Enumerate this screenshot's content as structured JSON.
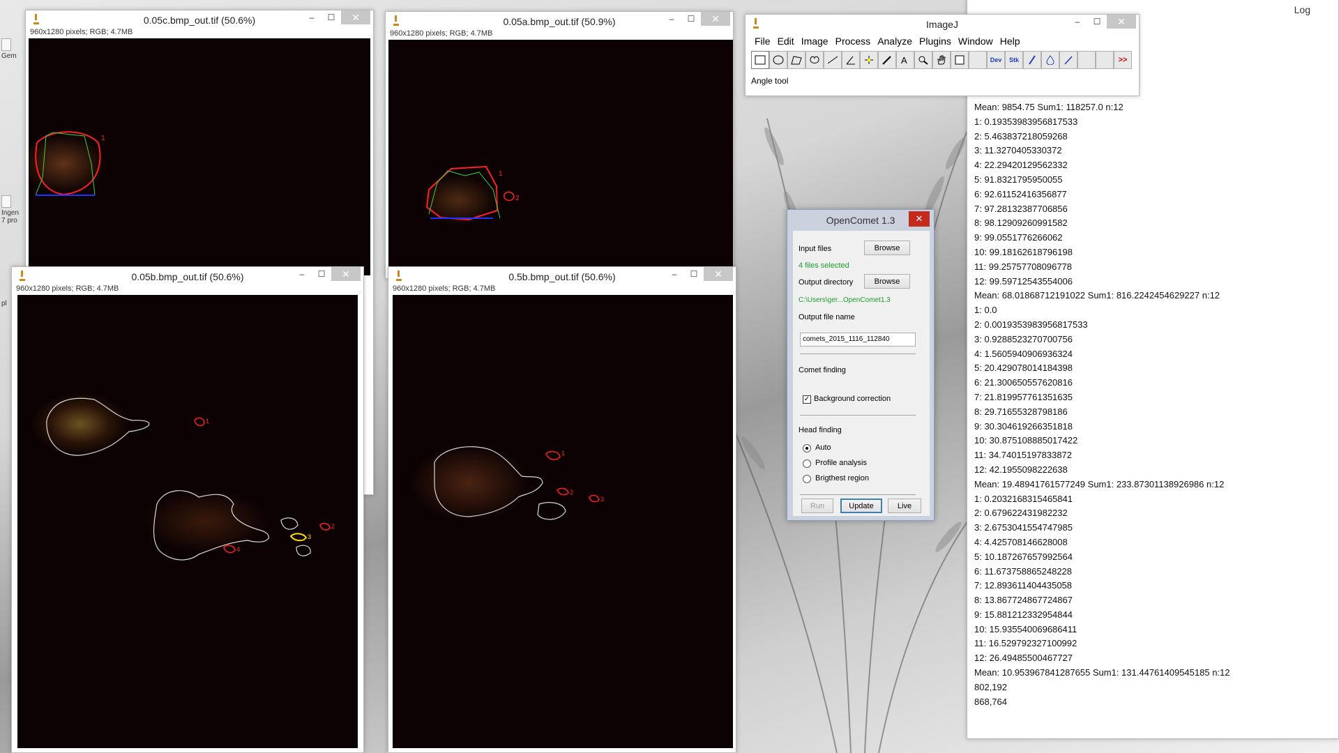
{
  "desktop": {
    "icon_labels": [
      "Gem",
      "Ingen\n7 pro",
      "pl"
    ]
  },
  "image_windows": [
    {
      "title": "0.05c.bmp_out.tif (50.6%)",
      "info": "960x1280 pixels; RGB; 4.7MB",
      "roi_labels": [
        "1"
      ]
    },
    {
      "title": "0.05a.bmp_out.tif (50.9%)",
      "info": "960x1280 pixels; RGB; 4.7MB",
      "roi_labels": [
        "1",
        "2"
      ]
    },
    {
      "title": "0.05b.bmp_out.tif (50.6%)",
      "info": "960x1280 pixels; RGB; 4.7MB",
      "roi_labels": [
        "1",
        "2",
        "3",
        "4"
      ]
    },
    {
      "title": "0.5b.bmp_out.tif (50.6%)",
      "info": "960x1280 pixels; RGB; 4.7MB",
      "roi_labels": [
        "1",
        "2",
        "3"
      ]
    }
  ],
  "imagej": {
    "title": "ImageJ",
    "menu": [
      "File",
      "Edit",
      "Image",
      "Process",
      "Analyze",
      "Plugins",
      "Window",
      "Help"
    ],
    "tools": [
      "rectangle-icon",
      "oval-icon",
      "polygon-icon",
      "freehand-icon",
      "line-icon",
      "angle-icon",
      "point-icon",
      "wand-icon",
      "text-icon",
      "magnifier-icon",
      "hand-icon",
      "color-picker-icon",
      "blank",
      "Dev",
      "Stk",
      "brush-icon",
      "flood-icon",
      "pencil-icon",
      "blank",
      "blank",
      ">>"
    ],
    "status": "Angle tool"
  },
  "log": {
    "title": "Log",
    "lines": [
      "Mean: 9854.75 Sum1: 118257.0 n:12",
      "1: 0.19353983956817533",
      "2: 5.463837218059268",
      "3: 11.3270405330372",
      "4: 22.29420129562332",
      "5: 91.8321795950055",
      "6: 92.61152416356877",
      "7: 97.28132387706856",
      "8: 98.12909260991582",
      "9: 99.0551776266062",
      "10: 99.18162618796198",
      "11: 99.25757708096778",
      "12: 99.59712543554006",
      "Mean: 68.01868712191022 Sum1: 816.2242454629227 n:12",
      "1: 0.0",
      "2: 0.0019353983956817533",
      "3: 0.9288523270700756",
      "4: 1.5605940906936324",
      "5: 20.429078014184398",
      "6: 21.300650557620816",
      "7: 21.819957761351635",
      "8: 29.71655328798186",
      "9: 30.304619266351818",
      "10: 30.875108885017422",
      "11: 34.74015197833872",
      "12: 42.1955098222638",
      "Mean: 19.48941761577249 Sum1: 233.87301138926986 n:12",
      "1: 0.2032168315465841",
      "2: 0.679622431982232",
      "3: 2.6753041554747985",
      "4: 4.425708146628008",
      "5: 10.187267657992564",
      "6: 11.673758865248228",
      "7: 12.893611404435058",
      "8: 13.867724867724867",
      "9: 15.881212332954844",
      "10: 15.935540069686411",
      "11: 16.529792327100992",
      "12: 26.49485500467727",
      "Mean: 10.953967841287655 Sum1: 131.44761409545185 n:12",
      "802,192",
      "868,764"
    ]
  },
  "opencomet": {
    "title": "OpenComet 1.3",
    "input_files_label": "Input files",
    "browse_label": "Browse",
    "files_selected": "4 files selected",
    "output_dir_label": "Output directory",
    "output_dir_value": "C:\\Users\\ger...OpenComet1.3",
    "output_name_label": "Output file name",
    "output_name_value": "comets_2015_1116_112840",
    "comet_finding_label": "Comet finding",
    "background_correction_label": "Background correction",
    "background_correction_checked": true,
    "head_finding_label": "Head finding",
    "head_options": [
      "Auto",
      "Profile analysis",
      "Brigthest region"
    ],
    "head_selected": "Auto",
    "run_label": "Run",
    "update_label": "Update",
    "live_label": "Live"
  },
  "colors": {
    "roi_red": "#ff2020",
    "roi_green": "#3fd43f",
    "roi_blue": "#2030ff",
    "roi_white": "#d8d8d8",
    "roi_yellow": "#ffe000",
    "files_selected_green": "#1b9c28",
    "close_red": "#c42b1c"
  }
}
